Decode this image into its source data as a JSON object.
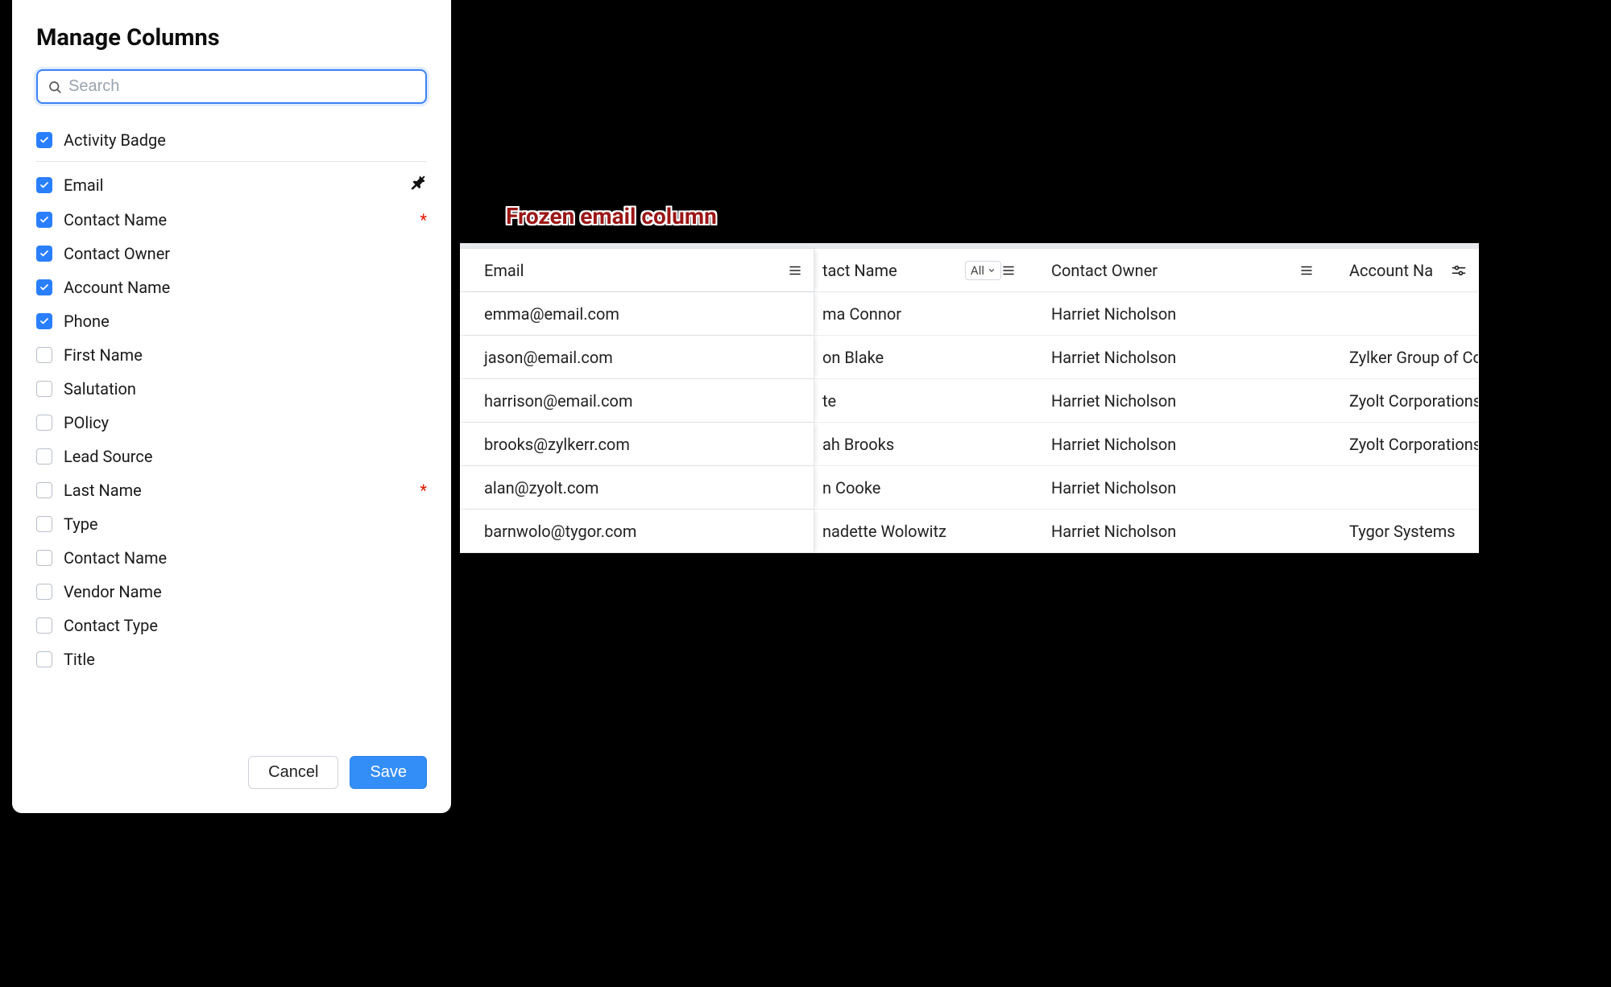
{
  "panel": {
    "title": "Manage Columns",
    "search_placeholder": "Search",
    "columns": [
      {
        "label": "Activity Badge",
        "checked": true,
        "required": false,
        "pinned": false,
        "first": true
      },
      {
        "label": "Email",
        "checked": true,
        "required": false,
        "pinned": true
      },
      {
        "label": "Contact Name",
        "checked": true,
        "required": true,
        "pinned": false
      },
      {
        "label": "Contact Owner",
        "checked": true,
        "required": false,
        "pinned": false
      },
      {
        "label": "Account Name",
        "checked": true,
        "required": false,
        "pinned": false
      },
      {
        "label": "Phone",
        "checked": true,
        "required": false,
        "pinned": false
      },
      {
        "label": "First Name",
        "checked": false,
        "required": false,
        "pinned": false
      },
      {
        "label": "Salutation",
        "checked": false,
        "required": false,
        "pinned": false
      },
      {
        "label": "POlicy",
        "checked": false,
        "required": false,
        "pinned": false
      },
      {
        "label": "Lead Source",
        "checked": false,
        "required": false,
        "pinned": false
      },
      {
        "label": "Last Name",
        "checked": false,
        "required": true,
        "pinned": false
      },
      {
        "label": "Type",
        "checked": false,
        "required": false,
        "pinned": false
      },
      {
        "label": "Contact Name",
        "checked": false,
        "required": false,
        "pinned": false
      },
      {
        "label": "Vendor Name",
        "checked": false,
        "required": false,
        "pinned": false
      },
      {
        "label": "Contact Type",
        "checked": false,
        "required": false,
        "pinned": false
      },
      {
        "label": "Title",
        "checked": false,
        "required": false,
        "pinned": false
      }
    ],
    "cancel": "Cancel",
    "save": "Save"
  },
  "annotation": "Frozen email column",
  "table": {
    "headers": {
      "email": "Email",
      "contact_name": "tact Name",
      "filter_label": "All",
      "contact_owner": "Contact Owner",
      "account_name": "Account Na"
    },
    "rows": [
      {
        "email": "emma@email.com",
        "cname": "ma Connor",
        "owner": "Harriet Nicholson",
        "account": ""
      },
      {
        "email": "jason@email.com",
        "cname": "on Blake",
        "owner": "Harriet Nicholson",
        "account": "Zylker Group of Co"
      },
      {
        "email": "harrison@email.com",
        "cname": "te",
        "owner": "Harriet Nicholson",
        "account": "Zyolt Corporations"
      },
      {
        "email": "brooks@zylkerr.com",
        "cname": "ah Brooks",
        "owner": "Harriet Nicholson",
        "account": "Zyolt Corporations"
      },
      {
        "email": "alan@zyolt.com",
        "cname": "n Cooke",
        "owner": "Harriet Nicholson",
        "account": ""
      },
      {
        "email": "barnwolo@tygor.com",
        "cname": "nadette Wolowitz",
        "owner": "Harriet Nicholson",
        "account": "Tygor Systems"
      }
    ]
  }
}
